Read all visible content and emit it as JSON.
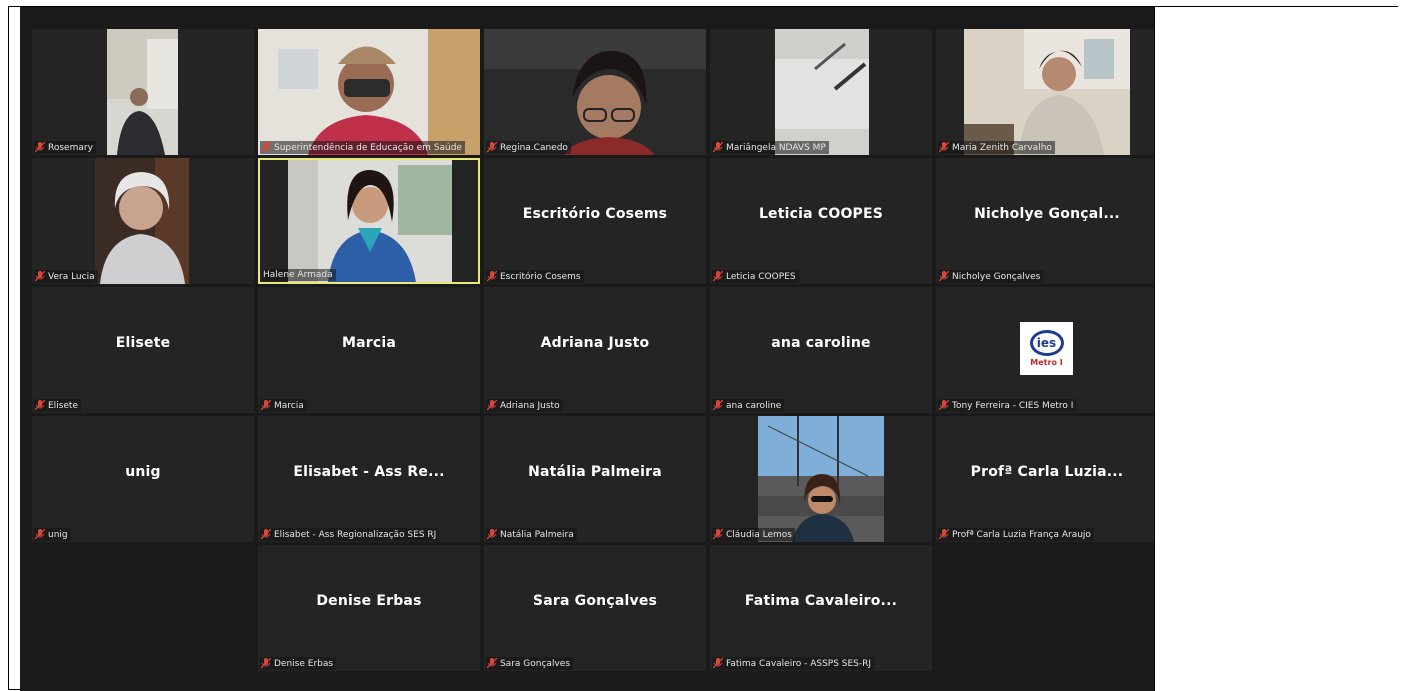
{
  "participants": [
    {
      "label": "Rosemary",
      "display": "",
      "video": true
    },
    {
      "label": "Superintendência de Educação em Saúde",
      "display": "",
      "video": true
    },
    {
      "label": "Regina.Canedo",
      "display": "",
      "video": true
    },
    {
      "label": "Mariângela NDAVS MP",
      "display": "",
      "video": true
    },
    {
      "label": "Maria Zenith Carvalho",
      "display": "",
      "video": true
    },
    {
      "label": "Vera Lucia",
      "display": "",
      "video": true
    },
    {
      "label": "Halene Armada",
      "display": "",
      "video": true,
      "active": true
    },
    {
      "label": "Escritório Cosems",
      "display": "Escritório Cosems"
    },
    {
      "label": "Leticia COOPES",
      "display": "Leticia COOPES"
    },
    {
      "label": "Nicholye Gonçalves",
      "display": "Nicholye  Gonçal..."
    },
    {
      "label": "Elisete",
      "display": "Elisete"
    },
    {
      "label": "Marcia",
      "display": "Marcia"
    },
    {
      "label": "Adriana Justo",
      "display": "Adriana Justo"
    },
    {
      "label": "ana caroline",
      "display": "ana caroline"
    },
    {
      "label": "Tony Ferreira - CIES Metro I",
      "display": "",
      "logo": true
    },
    {
      "label": "unig",
      "display": "unig"
    },
    {
      "label": "Elisabet - Ass Regionalização SES RJ",
      "display": "Elisabet - Ass Re..."
    },
    {
      "label": "Natália Palmeira",
      "display": "Natália Palmeira"
    },
    {
      "label": "Cláudia Lemos",
      "display": "",
      "video": true
    },
    {
      "label": "Profª Carla Luzia  França Araujo",
      "display": "Profª Carla Luzia..."
    },
    {
      "label": "",
      "display": "",
      "empty": true
    },
    {
      "label": "Denise Erbas",
      "display": "Denise Erbas"
    },
    {
      "label": "Sara Gonçalves",
      "display": "Sara Gonçalves"
    },
    {
      "label": "Fatima Cavaleiro - ASSPS SES-RJ",
      "display": "Fatima  Cavaleiro..."
    },
    {
      "label": "",
      "display": "",
      "empty": true
    }
  ],
  "logo": {
    "text": "ies",
    "subtext": "Metro I"
  },
  "colors": {
    "background": "#1a1a1a",
    "tile": "#242424",
    "active_border": "#e9e97a",
    "mic_muted": "#d9463a"
  }
}
